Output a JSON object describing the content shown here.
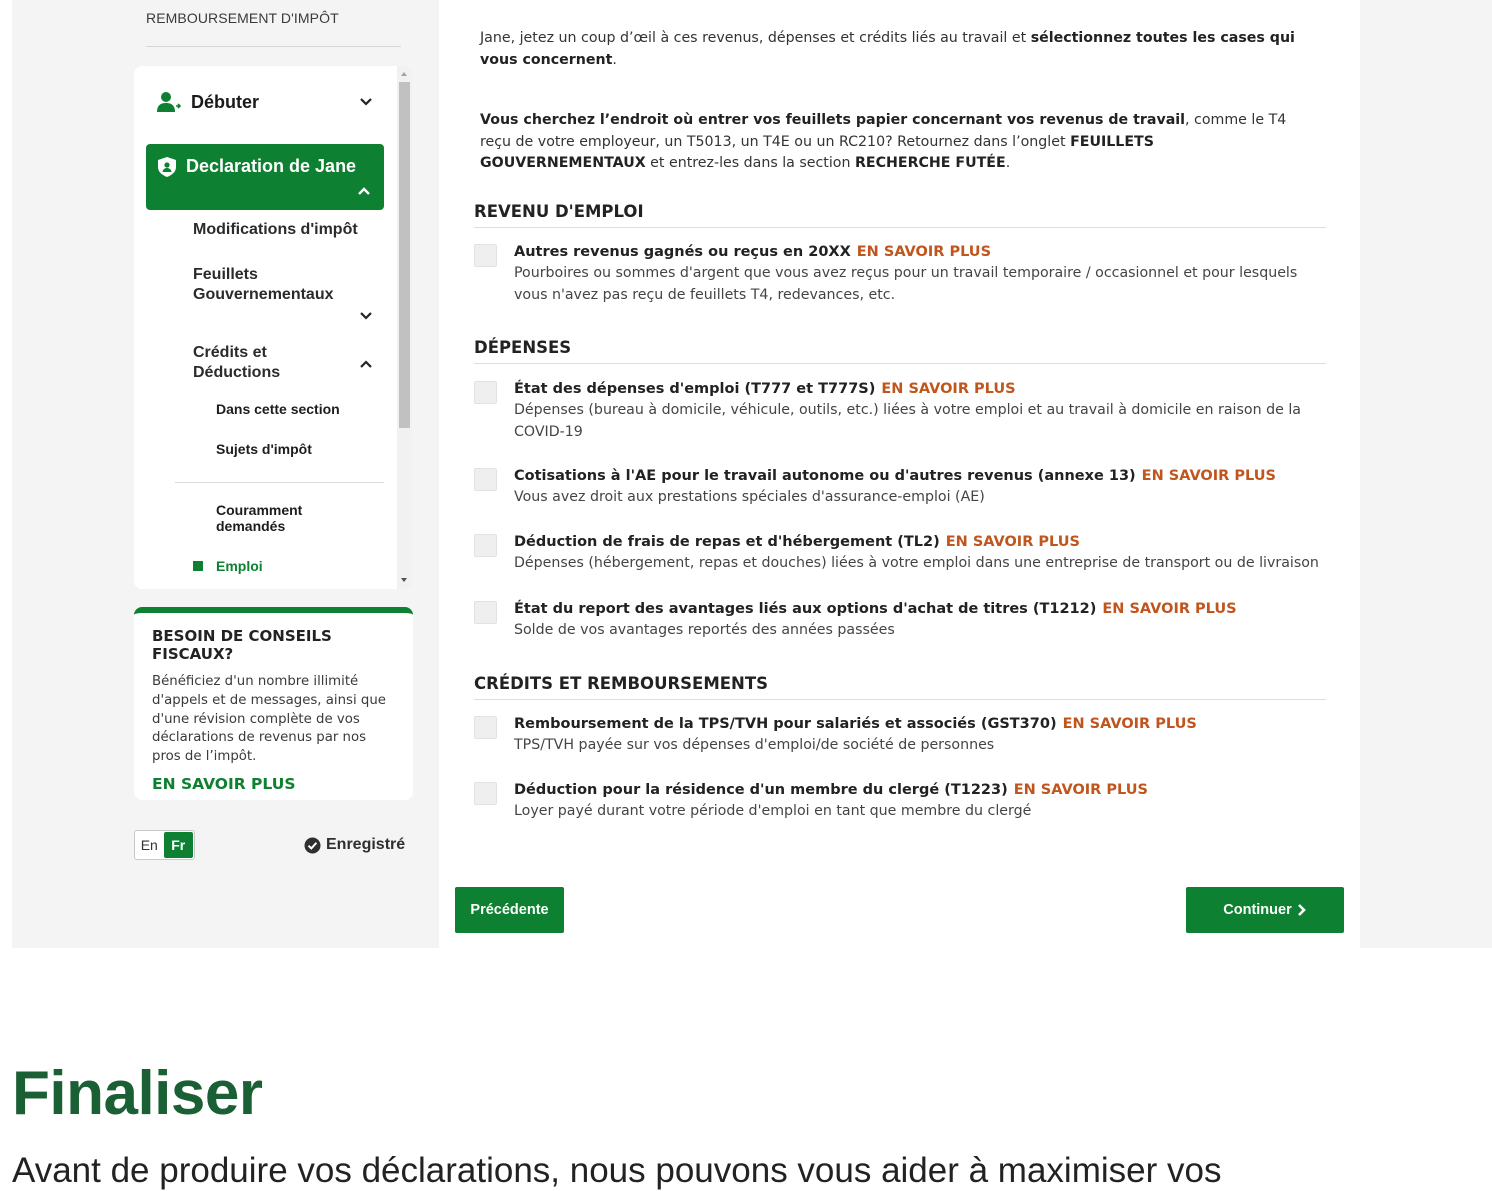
{
  "sidebar": {
    "title": "REMBOURSEMENT D'IMPÔT",
    "nav": {
      "debuter": "Débuter",
      "declaration": "Declaration de Jane",
      "modifications": "Modifications d'impôt",
      "feuillets_line1": "Feuillets",
      "feuillets_line2": "Gouvernementaux",
      "credits_line1": "Crédits et",
      "credits_line2": "Déductions",
      "dans_section": "Dans cette section",
      "sujets": "Sujets d'impôt",
      "couramment_line1": "Couramment",
      "couramment_line2": "demandés",
      "emploi": "Emploi"
    },
    "tips": {
      "title": "BESOIN DE CONSEILS FISCAUX?",
      "body": "Bénéficiez d'un nombre illimité d'appels et de messages, ainsi que d'une révision complète de vos déclarations de revenus par nos pros de l’impôt.",
      "link": "EN SAVOIR PLUS"
    },
    "lang": {
      "en": "En",
      "fr": "Fr",
      "selected": "Fr"
    },
    "saved": "Enregistré"
  },
  "main": {
    "intro": {
      "part1": "Jane, jetez un coup d’œil à ces revenus, dépenses et crédits liés au travail et ",
      "bold": "sélectionnez toutes les cases qui vous concernent",
      "part2": "."
    },
    "intro2": {
      "bold1": "Vous cherchez l’endroit où entrer vos feuillets papier concernant vos revenus de travail",
      "text1": ", comme le T4 reçu de votre employeur, un T5013, un T4E ou un RC210? Retournez dans l’onglet ",
      "bold2": "FEUILLETS GOUVERNEMENTAUX",
      "text2": " et entrez-les dans la section ",
      "bold3": "RECHERCHE FUTÉE",
      "text3": "."
    },
    "sections": {
      "revenu": {
        "title": "REVENU D'EMPLOI",
        "items": [
          {
            "title": "Autres revenus gagnés ou reçus en 20XX",
            "link": "EN SAVOIR PLUS",
            "desc": "Pourboires ou sommes d'argent que vous avez reçus pour un travail temporaire / occasionnel et pour lesquels vous n'avez pas reçu de feuillets T4, redevances, etc.",
            "checked": false
          }
        ]
      },
      "depenses": {
        "title": "DÉPENSES",
        "items": [
          {
            "title": "État des dépenses d'emploi (T777 et T777S)",
            "link": "EN SAVOIR PLUS",
            "desc": "Dépenses (bureau à domicile, véhicule, outils, etc.) liées à votre emploi et au travail à domicile en raison de la COVID-19",
            "checked": false
          },
          {
            "title": "Cotisations à l'AE pour le travail autonome ou d'autres revenus (annexe 13)",
            "link": "EN SAVOIR PLUS",
            "desc": "Vous avez droit aux prestations spéciales d'assurance-emploi (AE)",
            "checked": false
          },
          {
            "title": "Déduction de frais de repas et d'hébergement (TL2)",
            "link": "EN SAVOIR PLUS",
            "desc": "Dépenses (hébergement, repas et douches) liées à votre emploi dans une entreprise de transport ou de livraison",
            "checked": false
          },
          {
            "title": "État du report des avantages liés aux options d'achat de titres (T1212)",
            "link": "EN SAVOIR PLUS",
            "desc": "Solde de vos avantages reportés des années passées",
            "checked": false
          }
        ]
      },
      "credits": {
        "title": "CRÉDITS ET REMBOURSEMENTS",
        "items": [
          {
            "title": "Remboursement de la TPS/TVH pour salariés et associés (GST370)",
            "link": "EN SAVOIR PLUS",
            "desc": "TPS/TVH payée sur vos dépenses d'emploi/de société de personnes",
            "checked": false
          },
          {
            "title": "Déduction pour la résidence d'un membre du clergé (T1223)",
            "link": "EN SAVOIR PLUS",
            "desc": "Loyer payé durant votre période d'emploi en tant que membre du clergé",
            "checked": false
          }
        ]
      }
    },
    "buttons": {
      "prev": "Précédente",
      "next": "Continuer"
    }
  },
  "page": {
    "heading": "Finaliser",
    "text": "Avant de produire vos déclarations, nous pouvons vous aider à maximiser vos"
  },
  "colors": {
    "brand_green": "#0d8131",
    "link_orange": "#c0561d",
    "heading_green": "#1b5f35"
  },
  "icons": [
    "person-add-icon",
    "shield-icon",
    "chevron-down-icon",
    "chevron-up-icon",
    "check-circle-icon",
    "chevron-right-icon"
  ]
}
